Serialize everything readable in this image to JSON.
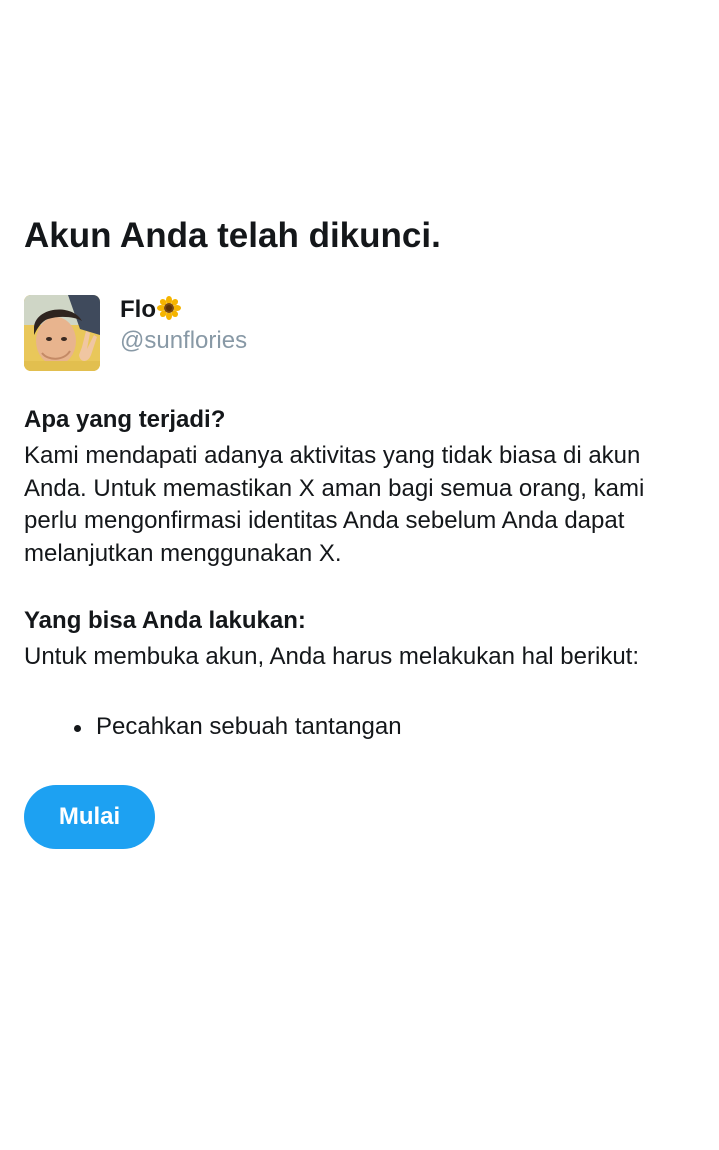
{
  "page": {
    "title": "Akun Anda telah dikunci."
  },
  "user": {
    "display_name": "Flo",
    "name_emoji": "sunflower-icon",
    "handle": "@sunflories",
    "avatar": "user-avatar"
  },
  "what_happened": {
    "heading": "Apa yang terjadi?",
    "body": "Kami mendapati adanya aktivitas yang tidak biasa di akun Anda. Untuk memastikan X aman bagi semua orang, kami perlu mengonfirmasi identitas Anda sebelum Anda dapat melanjutkan menggunakan X."
  },
  "what_you_can_do": {
    "heading": "Yang bisa Anda lakukan:",
    "body": "Untuk membuka akun, Anda harus melakukan hal berikut:",
    "steps": [
      "Pecahkan sebuah tantangan"
    ]
  },
  "actions": {
    "start_label": "Mulai"
  },
  "colors": {
    "accent": "#1da1f2",
    "text": "#14171a",
    "muted": "#8899a6",
    "background": "#ffffff"
  }
}
